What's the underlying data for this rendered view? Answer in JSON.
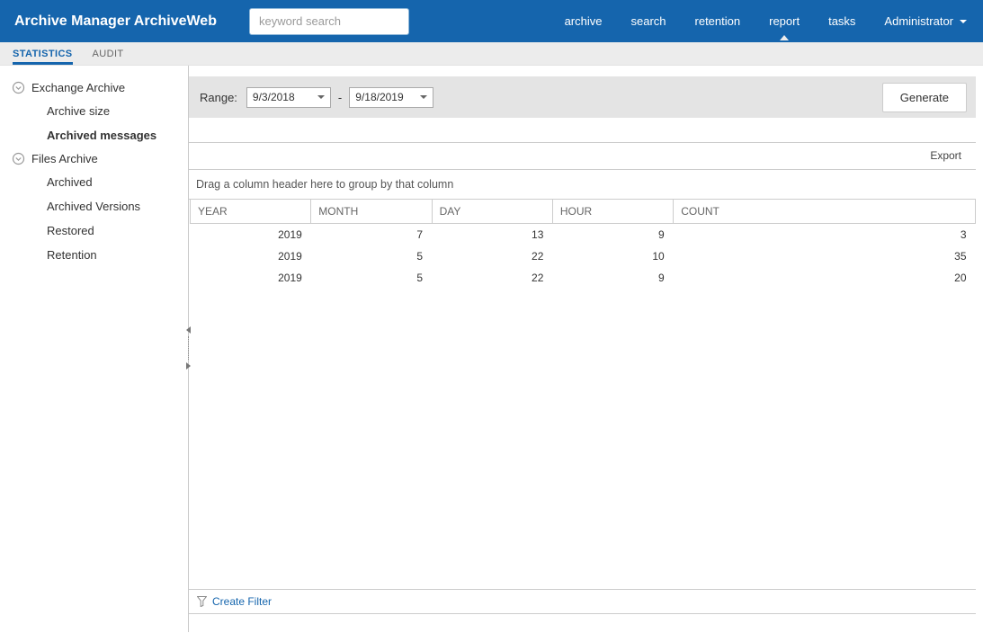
{
  "header": {
    "title": "Archive Manager ArchiveWeb",
    "search_placeholder": "keyword search",
    "nav": [
      {
        "label": "archive",
        "active": false
      },
      {
        "label": "search",
        "active": false
      },
      {
        "label": "retention",
        "active": false
      },
      {
        "label": "report",
        "active": true
      },
      {
        "label": "tasks",
        "active": false
      },
      {
        "label": "Administrator",
        "active": false,
        "has_dropdown": true
      }
    ]
  },
  "tabs": [
    {
      "label": "STATISTICS",
      "active": true
    },
    {
      "label": "AUDIT",
      "active": false
    }
  ],
  "sidebar": {
    "groups": [
      {
        "label": "Exchange Archive",
        "items": [
          {
            "label": "Archive size",
            "active": false
          },
          {
            "label": "Archived messages",
            "active": true
          }
        ]
      },
      {
        "label": "Files Archive",
        "items": [
          {
            "label": "Archived",
            "active": false
          },
          {
            "label": "Archived Versions",
            "active": false
          },
          {
            "label": "Restored",
            "active": false
          },
          {
            "label": "Retention",
            "active": false
          }
        ]
      }
    ]
  },
  "main": {
    "range_label": "Range:",
    "range_from": "9/3/2018",
    "range_separator": "-",
    "range_to": "9/18/2019",
    "generate_label": "Generate",
    "export_label": "Export",
    "group_hint": "Drag a column header here to group by that column",
    "table": {
      "columns": [
        "YEAR",
        "MONTH",
        "DAY",
        "HOUR",
        "COUNT"
      ],
      "rows": [
        [
          "2019",
          "7",
          "13",
          "9",
          "3"
        ],
        [
          "2019",
          "5",
          "22",
          "10",
          "35"
        ],
        [
          "2019",
          "5",
          "22",
          "9",
          "20"
        ]
      ]
    },
    "create_filter_label": "Create Filter"
  },
  "colors": {
    "header_bg": "#1565ad",
    "tabbar_bg": "#ececec",
    "rangebar_bg": "#e4e4e4",
    "accent_blue": "#1565ad"
  },
  "icons": {
    "nav_user_caret": "chevron-down-icon",
    "active_nav_marker": "active-nav-indicator",
    "tree_group": "collapse-icon",
    "filter": "funnel-icon",
    "splitter": "splitter-grip"
  }
}
